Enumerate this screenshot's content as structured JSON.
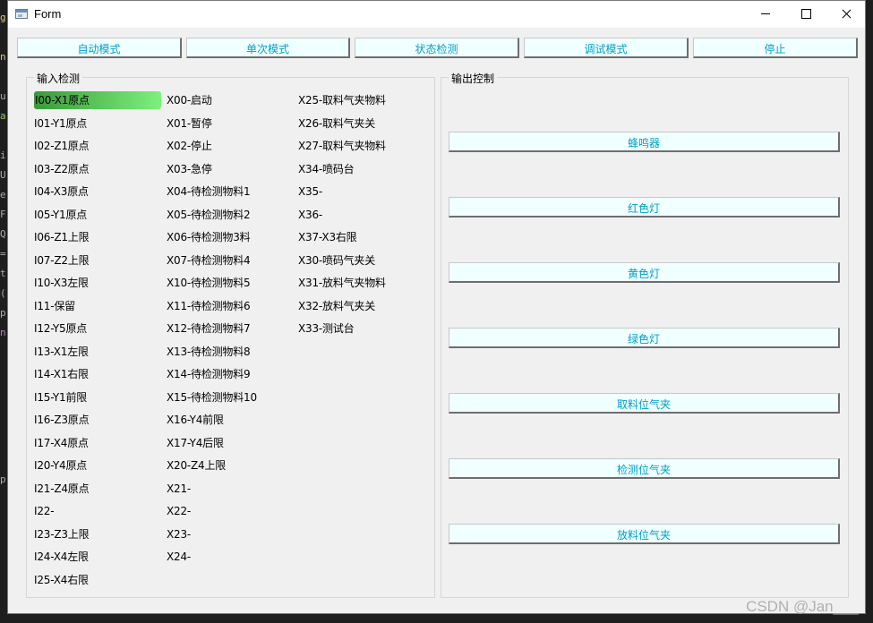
{
  "window": {
    "title": "Form"
  },
  "toolbar": {
    "buttons": [
      "自动模式",
      "单次模式",
      "状态检测",
      "调试模式",
      "停止"
    ]
  },
  "input_panel": {
    "title": "输入检测",
    "columns": [
      [
        "I00-X1原点",
        "I01-Y1原点",
        "I02-Z1原点",
        "I03-Z2原点",
        "I04-X3原点",
        "I05-Y1原点",
        "I06-Z1上限",
        "I07-Z2上限",
        "I10-X3左限",
        "I11-保留",
        "I12-Y5原点",
        "I13-X1左限",
        "I14-X1右限",
        "I15-Y1前限",
        "I16-Z3原点",
        "I17-X4原点",
        "I20-Y4原点",
        "I21-Z4原点",
        "I22-",
        "I23-Z3上限",
        "I24-X4左限",
        "I25-X4右限"
      ],
      [
        "X00-启动",
        "X01-暂停",
        "X02-停止",
        "X03-急停",
        "X04-待检测物料1",
        "X05-待检测物料2",
        "X06-待检测物3料",
        "X07-待检测物料4",
        "X10-待检测物料5",
        "X11-待检测物料6",
        "X12-待检测物料7",
        "X13-待检测物料8",
        "X14-待检测物料9",
        "X15-待检测物料10",
        "X16-Y4前限",
        "X17-Y4后限",
        "X20-Z4上限",
        "X21-",
        "X22-",
        "X23-",
        "X24-"
      ],
      [
        "X25-取料气夹物料",
        "X26-取料气夹关",
        "X27-取料气夹物料",
        "X34-喷码台",
        "X35-",
        "X36-",
        "X37-X3右限",
        "X30-喷码气夹关",
        "X31-放料气夹物料",
        "X32-放料气夹关",
        "X33-测试台"
      ]
    ],
    "active_item": "I00-X1原点",
    "active_color": "#5fd35f"
  },
  "output_panel": {
    "title": "输出控制",
    "buttons": [
      "蜂鸣器",
      "红色灯",
      "黄色灯",
      "绿色灯",
      "取料位气夹",
      "检测位气夹",
      "放料位气夹"
    ]
  },
  "watermark": "CSDN @Jan___",
  "colors": {
    "button_text": "#00a0c8",
    "button_bg": "#f0ffff",
    "window_bg": "#f0f0f0"
  },
  "editor_behind": {
    "glyphs": [
      "g",
      "n",
      "u",
      "a",
      "i",
      "U",
      "e",
      "F",
      "Q",
      "=",
      "t",
      "(",
      "p",
      "n",
      "p"
    ]
  }
}
